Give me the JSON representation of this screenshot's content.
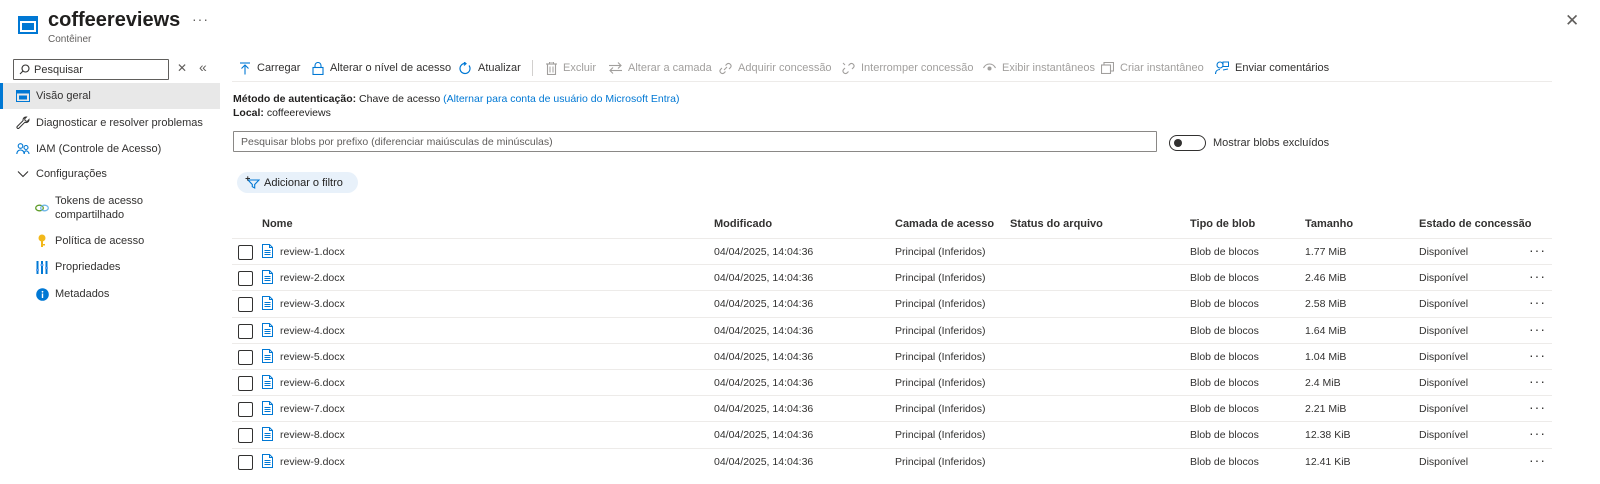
{
  "header": {
    "title": "coffeereviews",
    "subtitle": "Contêiner",
    "more": "···",
    "close": "✕"
  },
  "sidebar": {
    "search_placeholder": "Pesquisar",
    "clear": "✕",
    "collapse": "«",
    "items": [
      {
        "label": "Visão geral",
        "icon": "overview-icon"
      },
      {
        "label": "Diagnosticar e resolver problemas",
        "icon": "wrench-icon"
      },
      {
        "label": "IAM (Controle de Acesso)",
        "icon": "people-icon"
      },
      {
        "label": "Configurações",
        "icon": "chevron-down-icon"
      },
      {
        "label": "Tokens de acesso compartilhado",
        "icon": "link-icon"
      },
      {
        "label": "Política de acesso",
        "icon": "key-icon"
      },
      {
        "label": "Propriedades",
        "icon": "properties-icon"
      },
      {
        "label": "Metadados",
        "icon": "info-icon"
      }
    ]
  },
  "toolbar": {
    "upload": "Carregar",
    "change_access": "Alterar o nível de acesso",
    "refresh": "Atualizar",
    "delete": "Excluir",
    "change_tier": "Alterar a camada",
    "acquire_lease": "Adquirir concessão",
    "break_lease": "Interromper concessão",
    "view_snapshots": "Exibir instantâneos",
    "create_snapshot": "Criar instantâneo",
    "feedback": "Enviar comentários"
  },
  "info": {
    "auth_label": "Método de autenticação:",
    "auth_value": "Chave de acesso",
    "auth_link": "(Alternar para conta de usuário do Microsoft Entra)",
    "location_label": "Local:",
    "location_value": "coffeereviews"
  },
  "search": {
    "placeholder": "Pesquisar blobs por prefixo (diferenciar maiúsculas de minúsculas)",
    "toggle_label": "Mostrar blobs excluídos"
  },
  "filter": {
    "label": "Adicionar o filtro"
  },
  "table": {
    "columns": [
      "Nome",
      "Modificado",
      "Camada de acesso",
      "Status do arquivo",
      "Tipo de blob",
      "Tamanho",
      "Estado de concessão"
    ],
    "rows": [
      {
        "name": "review-1.docx",
        "modified": "04/04/2025, 14:04:36",
        "tier": "Principal (Inferidos)",
        "archive": "",
        "type": "Blob de blocos",
        "size": "1.77 MiB",
        "lease": "Disponível"
      },
      {
        "name": "review-2.docx",
        "modified": "04/04/2025, 14:04:36",
        "tier": "Principal (Inferidos)",
        "archive": "",
        "type": "Blob de blocos",
        "size": "2.46 MiB",
        "lease": "Disponível"
      },
      {
        "name": "review-3.docx",
        "modified": "04/04/2025, 14:04:36",
        "tier": "Principal (Inferidos)",
        "archive": "",
        "type": "Blob de blocos",
        "size": "2.58 MiB",
        "lease": "Disponível"
      },
      {
        "name": "review-4.docx",
        "modified": "04/04/2025, 14:04:36",
        "tier": "Principal (Inferidos)",
        "archive": "",
        "type": "Blob de blocos",
        "size": "1.64 MiB",
        "lease": "Disponível"
      },
      {
        "name": "review-5.docx",
        "modified": "04/04/2025, 14:04:36",
        "tier": "Principal (Inferidos)",
        "archive": "",
        "type": "Blob de blocos",
        "size": "1.04 MiB",
        "lease": "Disponível"
      },
      {
        "name": "review-6.docx",
        "modified": "04/04/2025, 14:04:36",
        "tier": "Principal (Inferidos)",
        "archive": "",
        "type": "Blob de blocos",
        "size": "2.4 MiB",
        "lease": "Disponível"
      },
      {
        "name": "review-7.docx",
        "modified": "04/04/2025, 14:04:36",
        "tier": "Principal (Inferidos)",
        "archive": "",
        "type": "Blob de blocos",
        "size": "2.21 MiB",
        "lease": "Disponível"
      },
      {
        "name": "review-8.docx",
        "modified": "04/04/2025, 14:04:36",
        "tier": "Principal (Inferidos)",
        "archive": "",
        "type": "Blob de blocos",
        "size": "12.38 KiB",
        "lease": "Disponível"
      },
      {
        "name": "review-9.docx",
        "modified": "04/04/2025, 14:04:36",
        "tier": "Principal (Inferidos)",
        "archive": "",
        "type": "Blob de blocos",
        "size": "12.41 KiB",
        "lease": "Disponível"
      }
    ],
    "row_more": "···"
  },
  "colors": {
    "accent": "#0078d4",
    "active_bg": "#e8e8e8",
    "pill_bg": "#e8f1fa"
  }
}
